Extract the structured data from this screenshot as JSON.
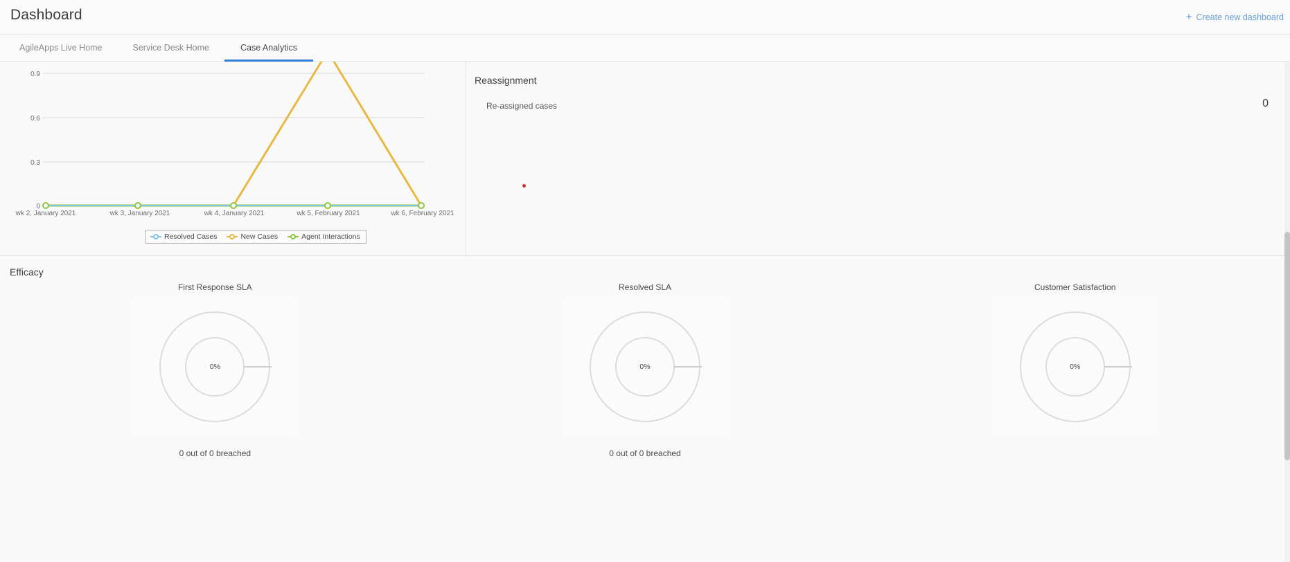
{
  "header": {
    "title": "Dashboard",
    "create_dashboard_label": "Create new dashboard",
    "plus_icon": "plus-icon"
  },
  "tabs": [
    {
      "label": "AgileApps Live Home",
      "active": false
    },
    {
      "label": "Service Desk Home",
      "active": false
    },
    {
      "label": "Case Analytics",
      "active": true
    }
  ],
  "reassignment": {
    "title": "Reassignment",
    "metric_label": "Re-assigned cases",
    "metric_value": "0",
    "dot_color": "#c0392b"
  },
  "efficacy": {
    "title": "Efficacy",
    "gauges": [
      {
        "title": "First Response SLA",
        "percent": "0%",
        "caption": "0 out of 0 breached"
      },
      {
        "title": "Resolved SLA",
        "percent": "0%",
        "caption": "0 out of 0 breached"
      },
      {
        "title": "Customer Satisfaction",
        "percent": "0%",
        "caption": ""
      }
    ]
  },
  "chart_data": {
    "type": "line",
    "title": "",
    "xlabel": "",
    "ylabel": "",
    "categories": [
      "wk 2, January 2021",
      "wk 3, January 2021",
      "wk 4, January 2021",
      "wk 5, February 2021",
      "wk 6, February 2021"
    ],
    "ytick_labels": [
      "0",
      "0.3",
      "0.6",
      "0.9"
    ],
    "ytick_values": [
      0,
      0.3,
      0.6,
      0.9
    ],
    "ylim": [
      0,
      1.05
    ],
    "grid": true,
    "legend_position": "bottom",
    "series": [
      {
        "name": "Resolved Cases",
        "color": "#7fc7e8",
        "values": [
          0,
          0,
          0,
          0,
          0
        ]
      },
      {
        "name": "New Cases",
        "color": "#e8b842",
        "values": [
          0,
          0,
          0,
          1,
          0
        ]
      },
      {
        "name": "Agent Interactions",
        "color": "#8cc63e",
        "values": [
          0,
          0,
          0,
          0,
          0
        ]
      }
    ]
  },
  "colors": {
    "accent": "#2f7ed8",
    "link": "#6b9fd4",
    "background": "#f9f9f9",
    "border": "#e3e3e3"
  }
}
